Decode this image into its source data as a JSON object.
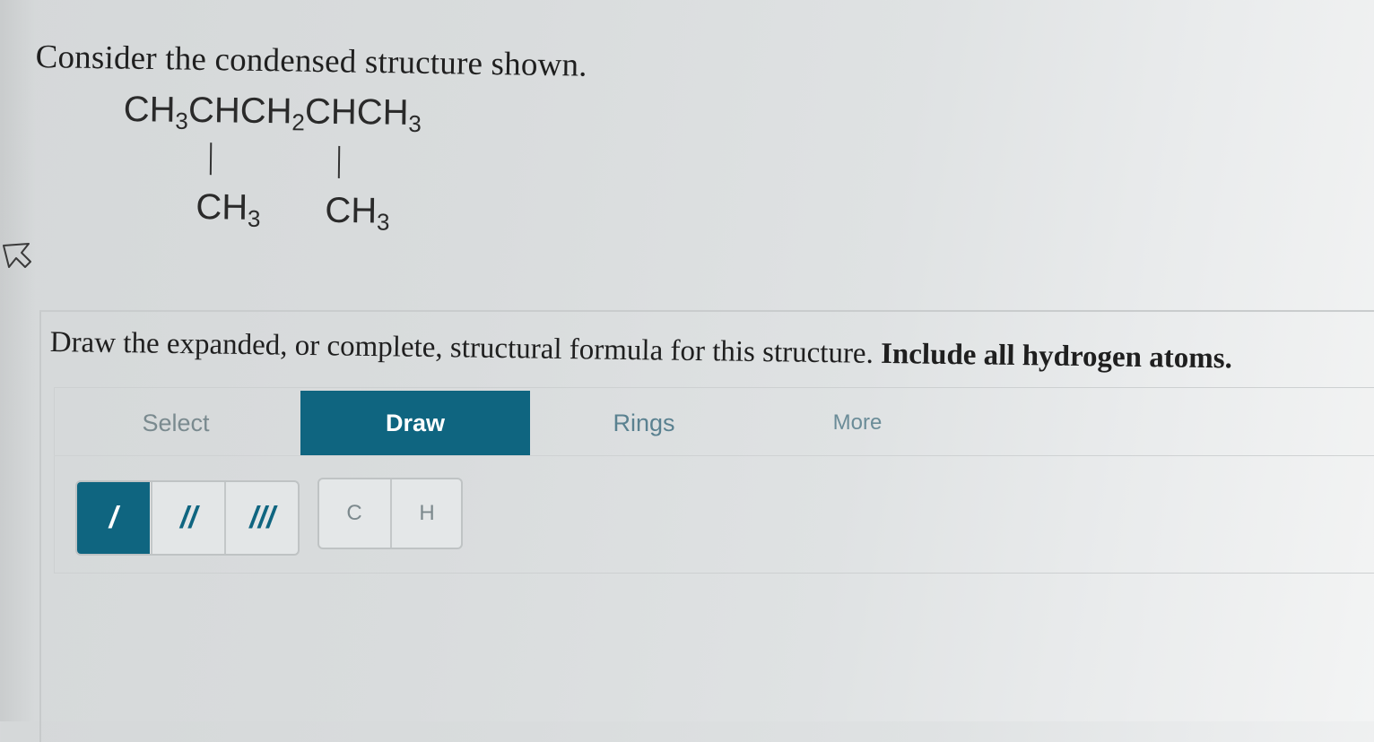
{
  "question": {
    "prompt": "Consider the condensed structure shown.",
    "structure": {
      "main_chain": [
        "CH",
        "3",
        "CHCH",
        "2",
        "CHCH",
        "3"
      ],
      "branch_left": [
        "CH",
        "3"
      ],
      "branch_right": [
        "CH",
        "3"
      ]
    },
    "instruction_regular": "Draw the expanded, or complete, structural formula for this structure. ",
    "instruction_bold": "Include all hydrogen atoms."
  },
  "toolbar": {
    "tabs": [
      {
        "label": "Select",
        "active": false
      },
      {
        "label": "Draw",
        "active": true
      },
      {
        "label": "Rings",
        "active": false
      },
      {
        "label": "More",
        "active": false
      }
    ],
    "bond_buttons": [
      {
        "label": "/",
        "active": true
      },
      {
        "label": "//",
        "active": false
      },
      {
        "label": "///",
        "active": false
      }
    ],
    "atom_buttons": [
      {
        "label": "C"
      },
      {
        "label": "H"
      }
    ]
  },
  "colors": {
    "accent": "#0f6580",
    "tab_text": "#4f7d8a",
    "border": "#c3c7c8"
  }
}
